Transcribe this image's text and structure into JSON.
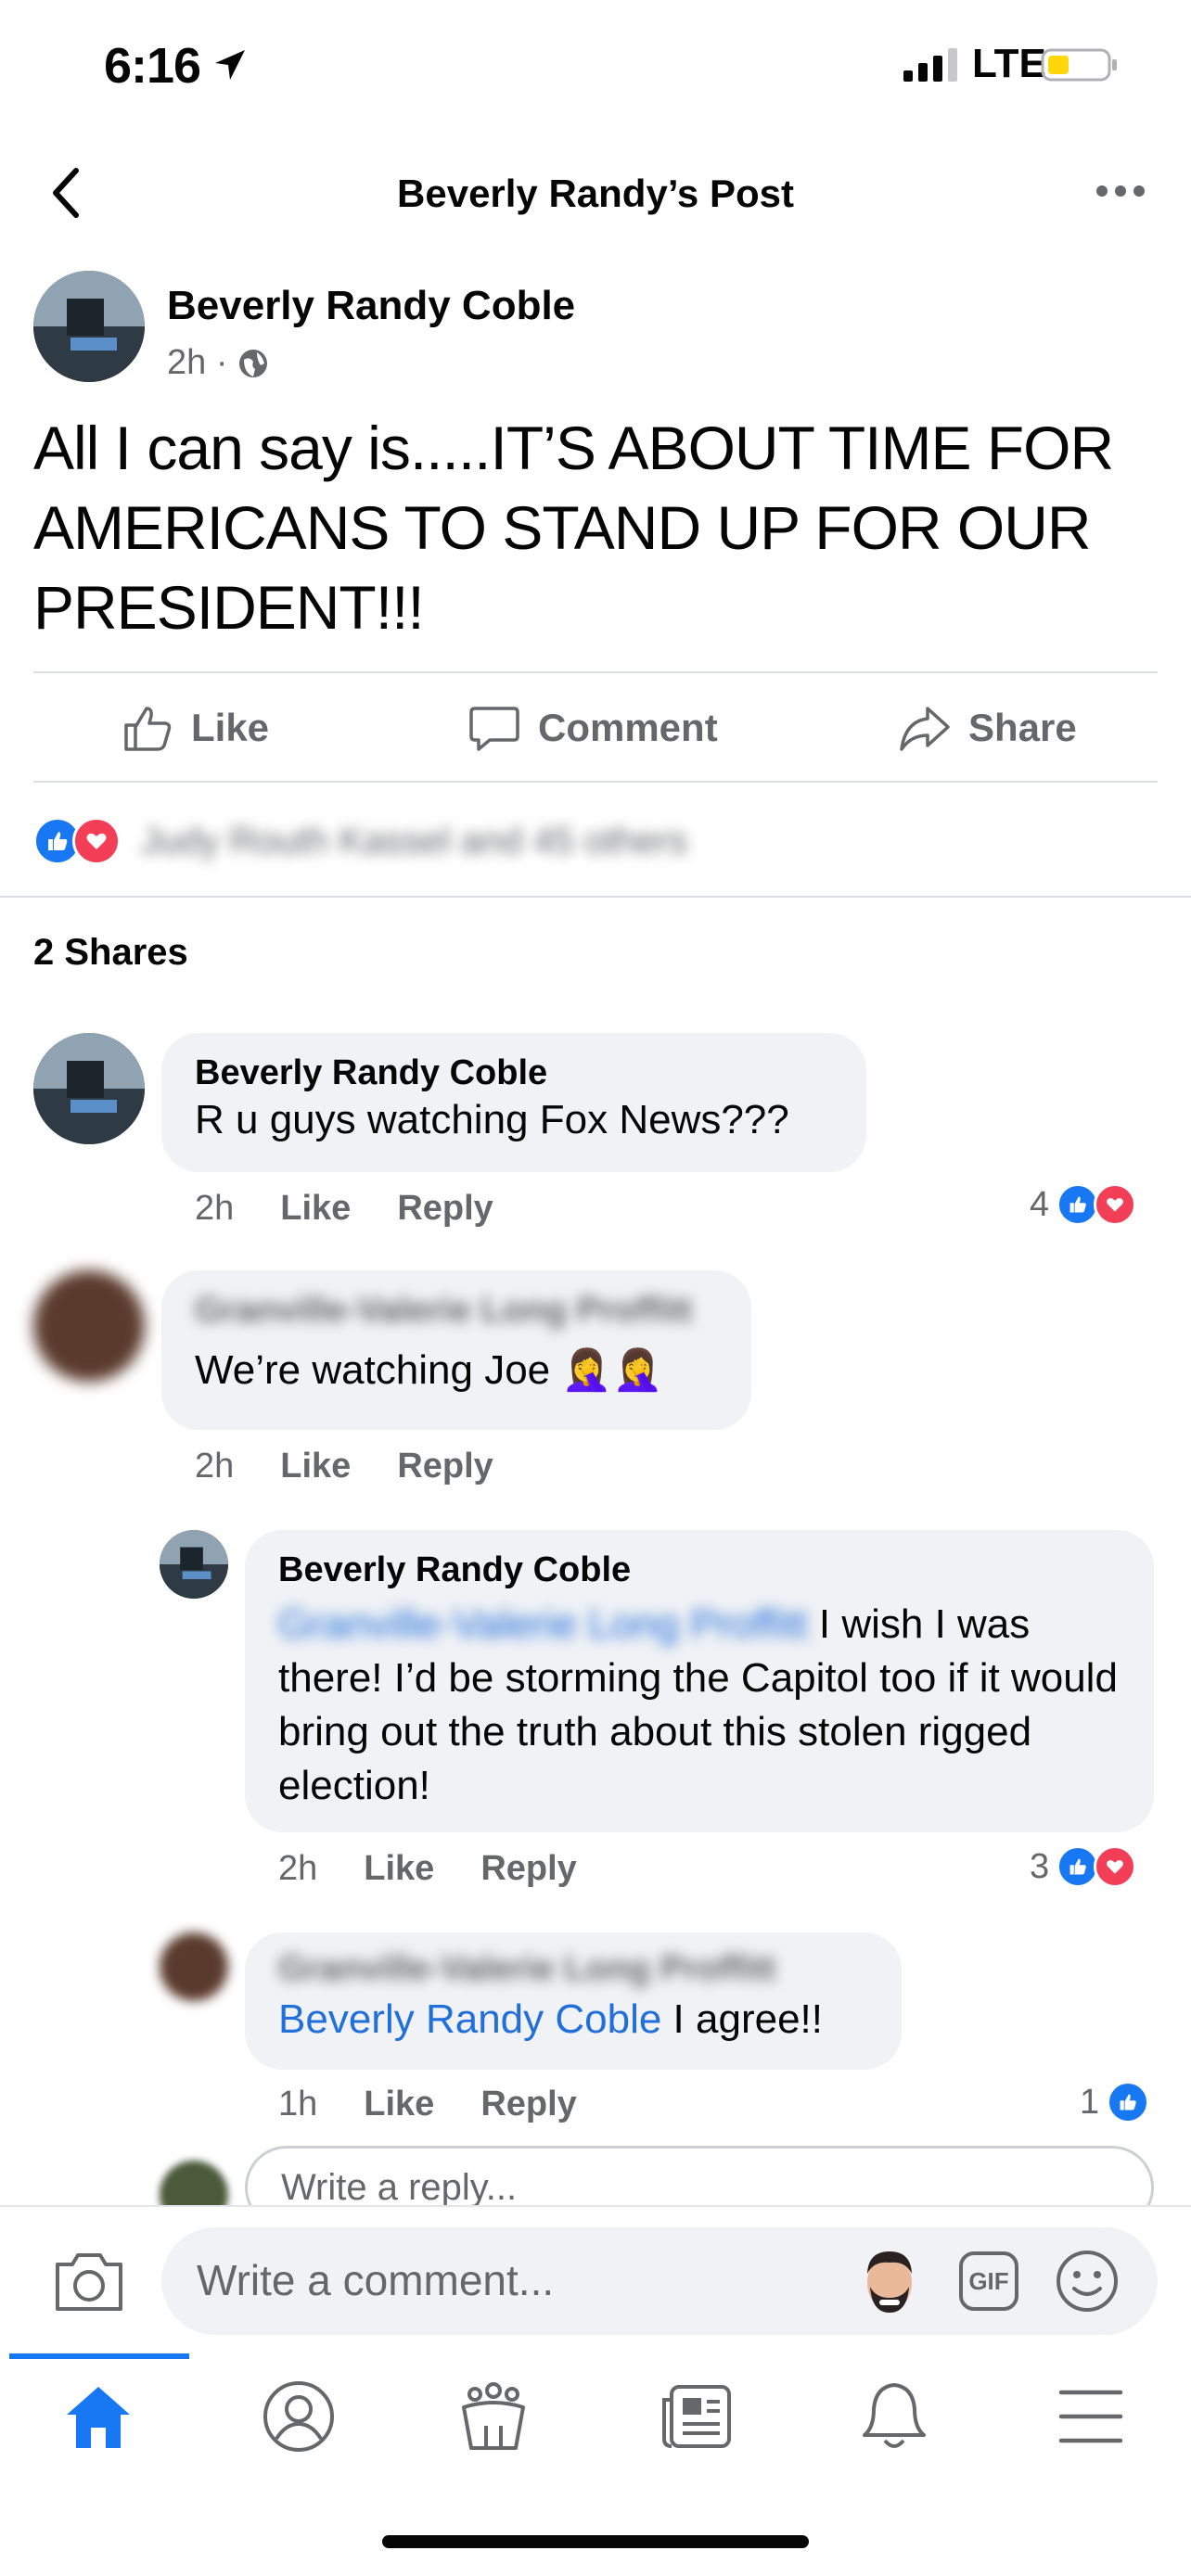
{
  "status_bar": {
    "time": "6:16",
    "carrier": "LTE"
  },
  "header": {
    "title": "Beverly Randy’s Post"
  },
  "post": {
    "author": "Beverly Randy Coble",
    "time": "2h ·",
    "text": "All I can say is.....IT’S ABOUT TIME FOR AMERICANS TO STAND UP FOR OUR PRESIDENT!!!",
    "actions": {
      "like": "Like",
      "comment": "Comment",
      "share": "Share"
    },
    "reactions_text": "Judy Routh Kassel and 45 others",
    "shares": "2 Shares"
  },
  "comments": [
    {
      "name": "Beverly Randy Coble",
      "text": "R u guys watching Fox News???",
      "time": "2h",
      "like": "Like",
      "reply": "Reply",
      "reaction_count": "4"
    },
    {
      "name": "Granville-Valerie Long Proffitt",
      "text": "We’re watching Joe 🤦‍♀️🤦‍♀️",
      "time": "2h",
      "like": "Like",
      "reply": "Reply"
    },
    {
      "name": "Beverly Randy Coble",
      "mention": "Granville-Valerie Long Proffitt",
      "text": " I wish I was there! I’d be storming the Capitol too if it would bring out the truth about this stolen rigged election!",
      "time": "2h",
      "like": "Like",
      "reply": "Reply",
      "reaction_count": "3"
    },
    {
      "name": "Granville-Valerie Long Proffitt",
      "mention": "Beverly Randy Coble",
      "text": " I agree!!",
      "time": "1h",
      "like": "Like",
      "reply": "Reply",
      "reaction_count": "1"
    }
  ],
  "reply_box": {
    "placeholder": "Write a reply..."
  },
  "comment_bar": {
    "placeholder": "Write a comment...",
    "gif_label": "GIF"
  },
  "tabs": [
    "home-icon",
    "profile-icon",
    "groups-icon",
    "news-icon",
    "notifications-icon",
    "menu-icon"
  ],
  "colors": {
    "accent": "#1877f2",
    "link": "#216fdb",
    "like_blue": "#1877f2",
    "love_red": "#f33e58",
    "bubble": "#f0f2f5"
  }
}
